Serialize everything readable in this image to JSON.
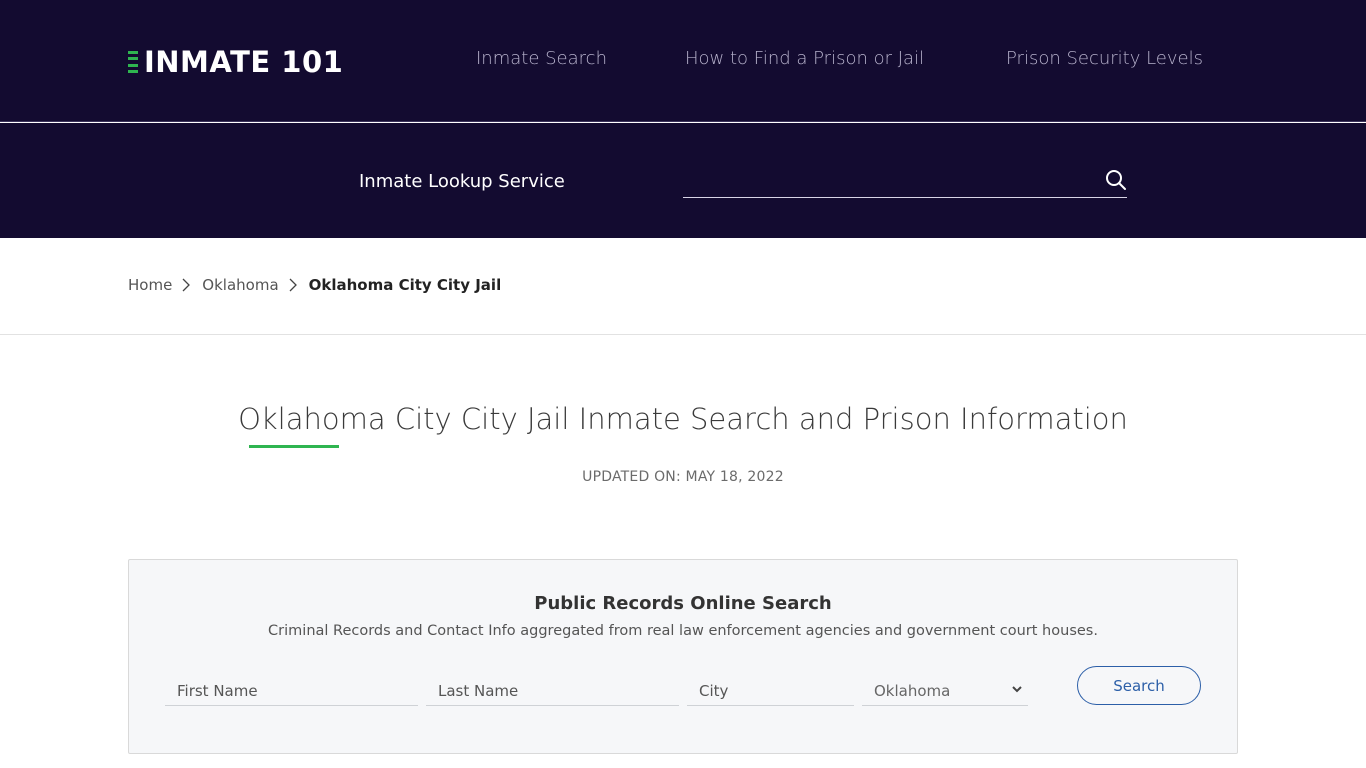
{
  "header": {
    "logo_text": "INMATE 101",
    "nav": [
      {
        "label": "Inmate Search"
      },
      {
        "label": "How to Find a Prison or Jail"
      },
      {
        "label": "Prison Security Levels"
      }
    ],
    "lookup": {
      "label": "Inmate Lookup Service",
      "placeholder": "",
      "icon": "search-icon"
    }
  },
  "breadcrumb": {
    "items": [
      {
        "label": "Home"
      },
      {
        "label": "Oklahoma"
      }
    ],
    "current": "Oklahoma City City Jail"
  },
  "main": {
    "title": "Oklahoma City City Jail Inmate Search and Prison Information",
    "updated": "UPDATED ON: MAY 18, 2022"
  },
  "search_card": {
    "title": "Public Records Online Search",
    "subtitle": "Criminal Records and Contact Info aggregated from real law enforcement agencies and government court houses.",
    "fields": {
      "first_name_placeholder": "First Name",
      "last_name_placeholder": "Last Name",
      "city_placeholder": "City",
      "state_selected": "Oklahoma"
    },
    "button_label": "Search"
  },
  "colors": {
    "header_bg": "#130b30",
    "accent_green": "#2fb550",
    "button_blue": "#2c5fa8"
  }
}
